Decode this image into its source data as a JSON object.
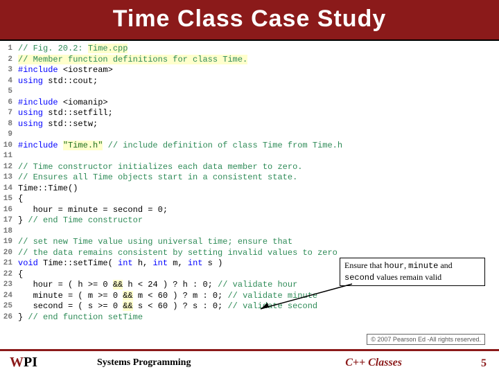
{
  "header": {
    "title": "Time Class Case Study"
  },
  "lines": [
    {
      "n": "1",
      "html": "<span class='c'>// Fig. 20.2: </span><span class='c hl'>Time.cpp</span>"
    },
    {
      "n": "2",
      "html": "<span class='c hl'>// Member function definitions for class Time.</span>"
    },
    {
      "n": "3",
      "html": "<span class='pp'>#include</span> <span class='id'>&lt;iostream&gt;</span>"
    },
    {
      "n": "4",
      "html": "<span class='kw'>using</span> std::cout;"
    },
    {
      "n": "5",
      "html": ""
    },
    {
      "n": "6",
      "html": "<span class='pp'>#include</span> <span class='id'>&lt;iomanip&gt;</span>"
    },
    {
      "n": "7",
      "html": "<span class='kw'>using</span> std::setfill;"
    },
    {
      "n": "8",
      "html": "<span class='kw'>using</span> std::setw;"
    },
    {
      "n": "9",
      "html": ""
    },
    {
      "n": "10",
      "html": "<span class='pp'>#include</span> <span class='str'>\"Time.h\"</span> <span class='c'>// include definition of class Time from Time.h</span>"
    },
    {
      "n": "11",
      "html": ""
    },
    {
      "n": "12",
      "html": "<span class='c'>// Time constructor initializes each data member to zero.</span>"
    },
    {
      "n": "13",
      "html": "<span class='c'>// Ensures all Time objects start in a consistent state.</span>"
    },
    {
      "n": "14",
      "html": "Time::Time()"
    },
    {
      "n": "15",
      "html": "{"
    },
    {
      "n": "16",
      "html": "   hour = minute = second = 0;"
    },
    {
      "n": "17",
      "html": "} <span class='c'>// end Time constructor</span>"
    },
    {
      "n": "18",
      "html": ""
    },
    {
      "n": "19",
      "html": "<span class='c'>// set new Time value using universal time; ensure that</span>"
    },
    {
      "n": "20",
      "html": "<span class='c'>// the data remains consistent by setting invalid values to zero</span>"
    },
    {
      "n": "21",
      "html": "<span class='kw'>void</span> Time::setTime( <span class='kw'>int</span> h, <span class='kw'>int</span> m, <span class='kw'>int</span> s )"
    },
    {
      "n": "22",
      "html": "{"
    },
    {
      "n": "23",
      "html": "   hour = ( h &gt;= 0 <span class='hl'>&amp;&amp;</span> h &lt; 24 ) ? h : 0; <span class='c'>// validate hour</span>"
    },
    {
      "n": "24",
      "html": "   minute = ( m &gt;= 0 <span class='hl'>&amp;&amp;</span> m &lt; 60 ) ? m : 0; <span class='c'>// validate minute</span>"
    },
    {
      "n": "25",
      "html": "   second = ( s &gt;= 0 <span class='hl'>&amp;&amp;</span> s &lt; 60 ) ? s : 0; <span class='c'>// validate second</span>"
    },
    {
      "n": "26",
      "html": "} <span class='c'>// end function setTime</span>"
    }
  ],
  "callout": {
    "t1": "Ensure that ",
    "m1": "hour",
    "t2": ", ",
    "m2": "minute",
    "t3": " and ",
    "m3": "second",
    "t4": " values remain valid"
  },
  "copyright": "© 2007 Pearson Ed -All rights reserved.",
  "footer": {
    "center": "Systems Programming",
    "title": "C++ Classes",
    "page": "5",
    "logo_w": "W",
    "logo_pi": "PI"
  }
}
